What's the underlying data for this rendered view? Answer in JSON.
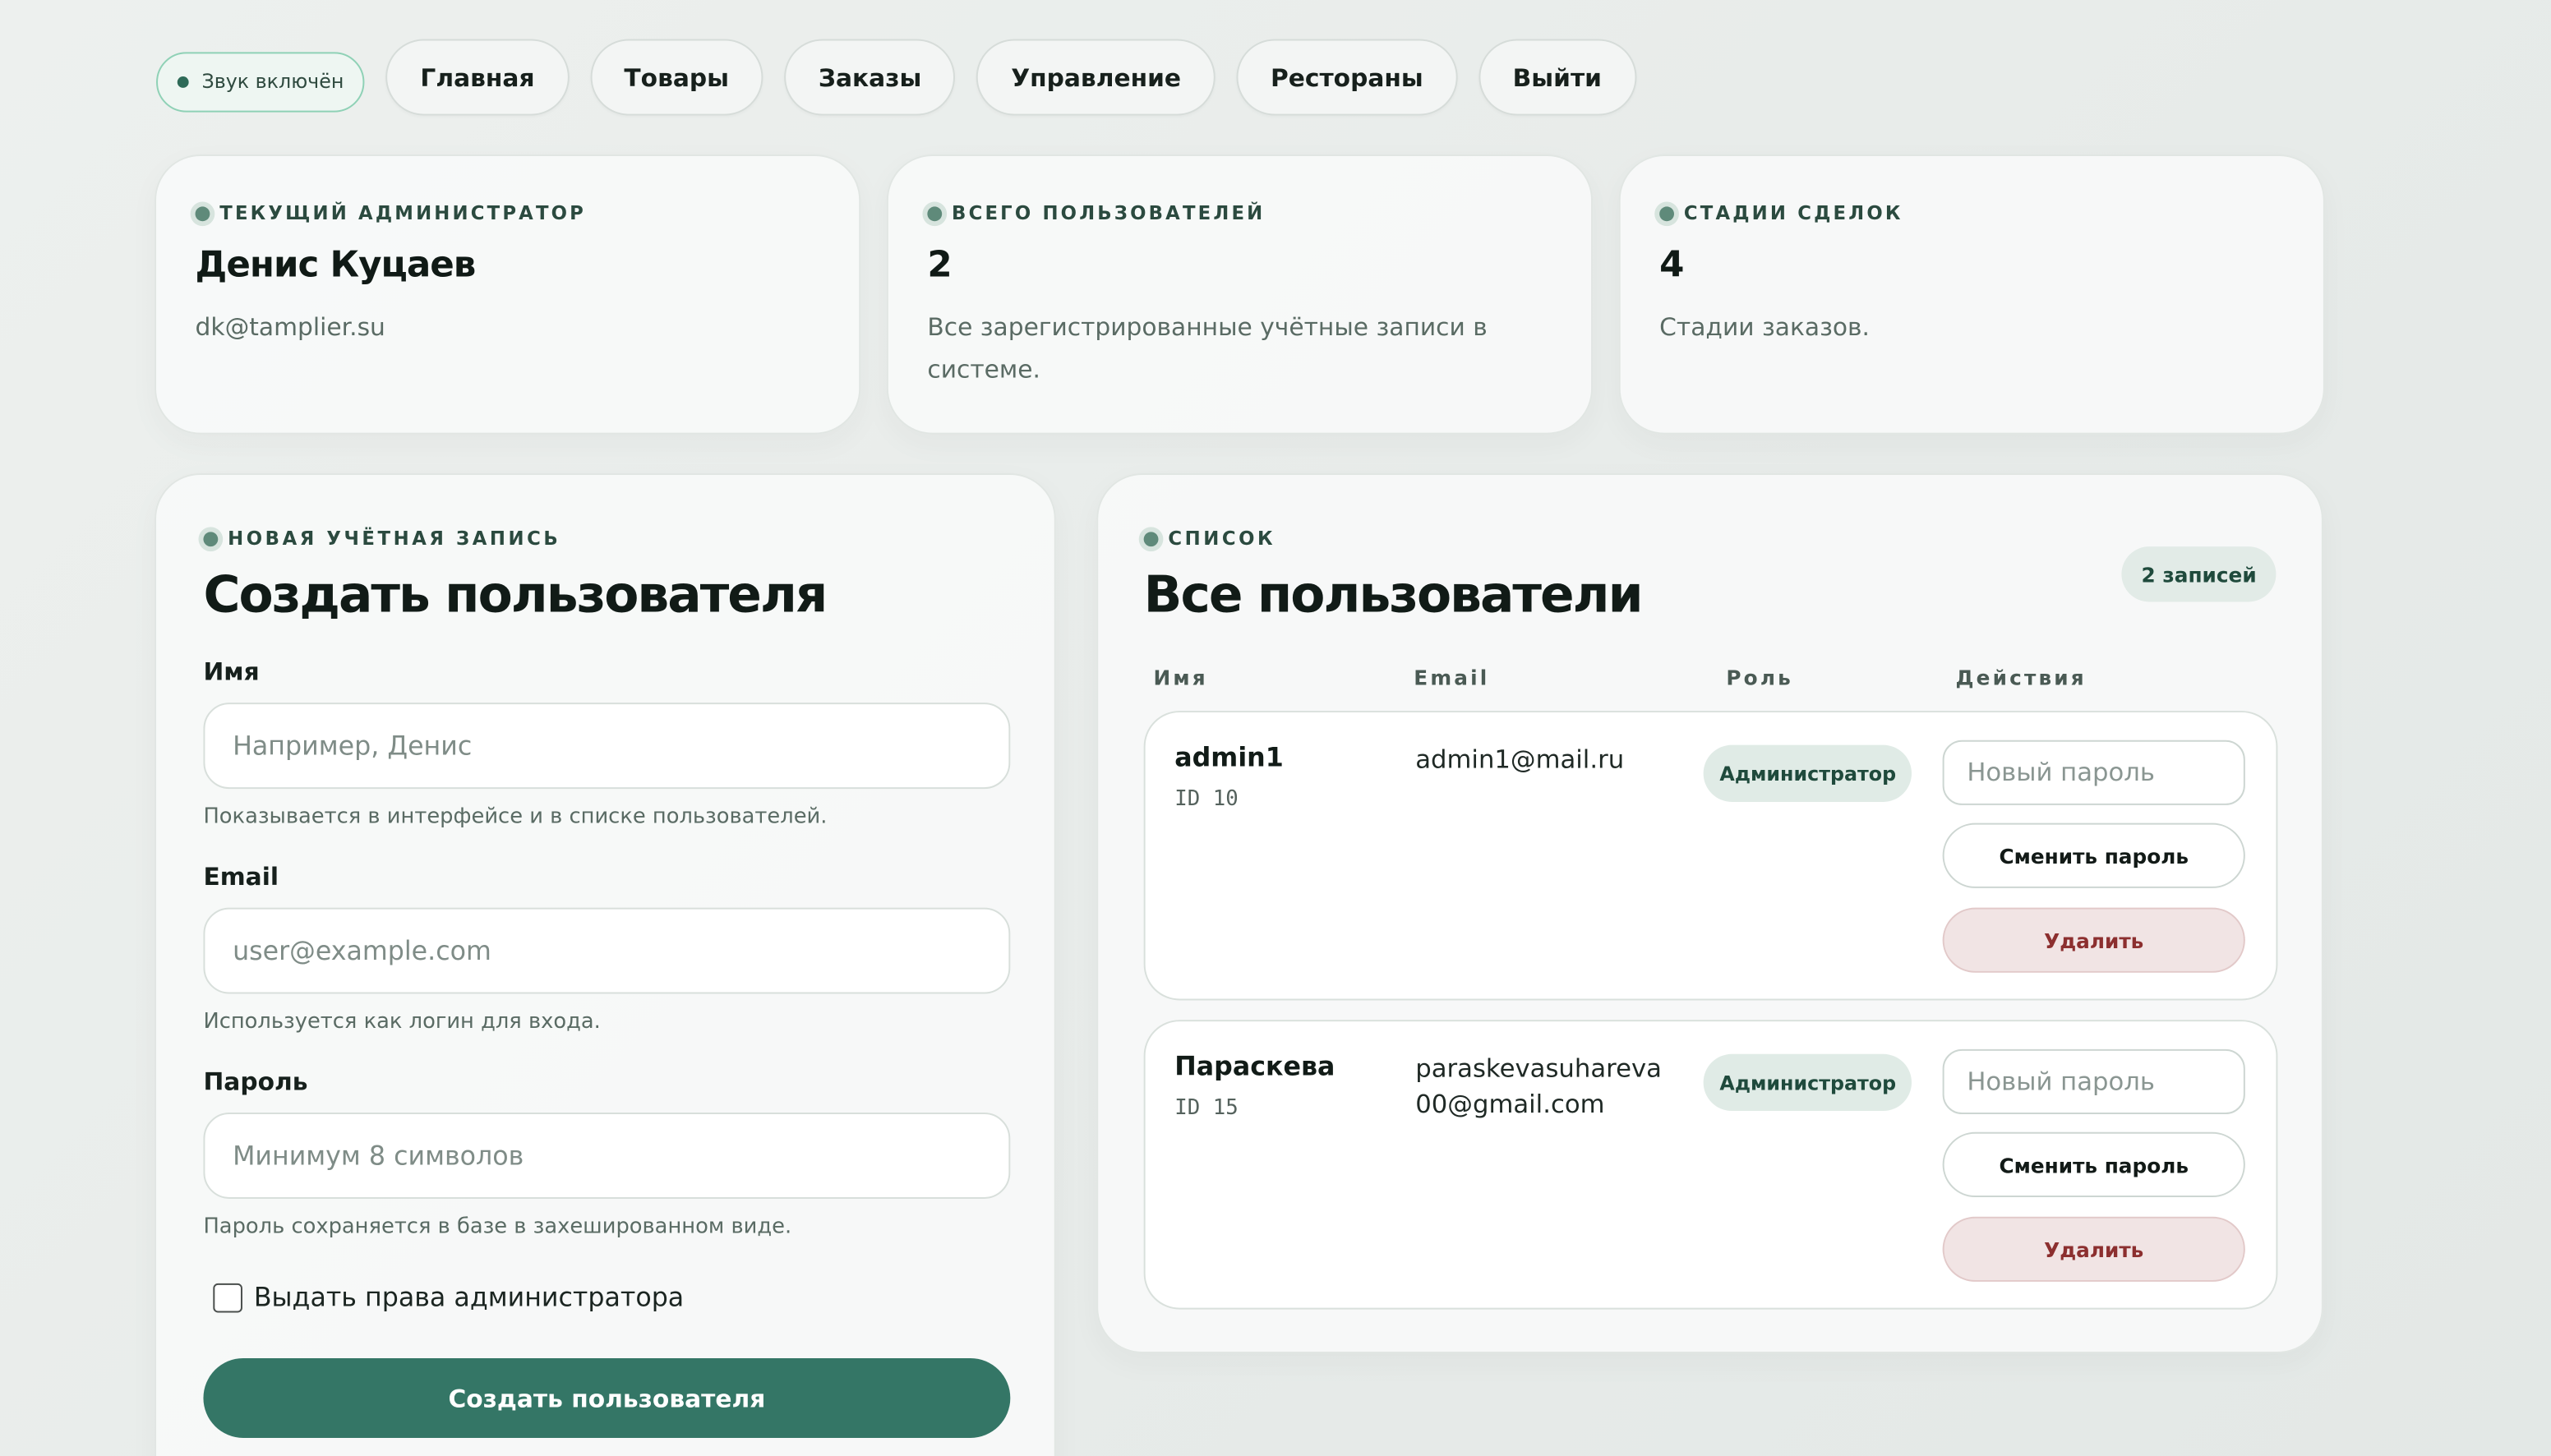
{
  "nav": {
    "sound": "Звук включён",
    "items": [
      "Главная",
      "Товары",
      "Заказы",
      "Управление",
      "Рестораны",
      "Выйти"
    ]
  },
  "stats": [
    {
      "kicker": "Текущий администратор",
      "title": "Денис Куцаев",
      "sub": "dk@tamplier.su"
    },
    {
      "kicker": "Всего пользователей",
      "title": "2",
      "sub": "Все зарегистрированные учётные записи в системе."
    },
    {
      "kicker": "Стадии сделок",
      "title": "4",
      "sub": "Стадии заказов."
    }
  ],
  "create": {
    "kicker": "Новая учётная запись",
    "title": "Создать пользователя",
    "name_label": "Имя",
    "name_placeholder": "Например, Денис",
    "name_hint": "Показывается в интерфейсе и в списке пользователей.",
    "email_label": "Email",
    "email_placeholder": "user@example.com",
    "email_hint": "Используется как логин для входа.",
    "password_label": "Пароль",
    "password_placeholder": "Минимум 8 символов",
    "password_hint": "Пароль сохраняется в базе в захешированном виде.",
    "admin_checkbox": "Выдать права администратора",
    "submit": "Создать пользователя"
  },
  "list": {
    "kicker": "Список",
    "title": "Все пользователи",
    "count": "2 записей",
    "columns": [
      "Имя",
      "Email",
      "Роль",
      "Действия"
    ],
    "rows": [
      {
        "name": "admin1",
        "id": "ID 10",
        "email": "admin1@mail.ru",
        "role": "Администратор",
        "password_placeholder": "Новый пароль",
        "change": "Сменить пароль",
        "delete": "Удалить"
      },
      {
        "name": "Параскева",
        "id": "ID 15",
        "email": "paraskevasuhareva00@gmail.com",
        "role": "Администратор",
        "password_placeholder": "Новый пароль",
        "change": "Сменить пароль",
        "delete": "Удалить"
      }
    ]
  }
}
